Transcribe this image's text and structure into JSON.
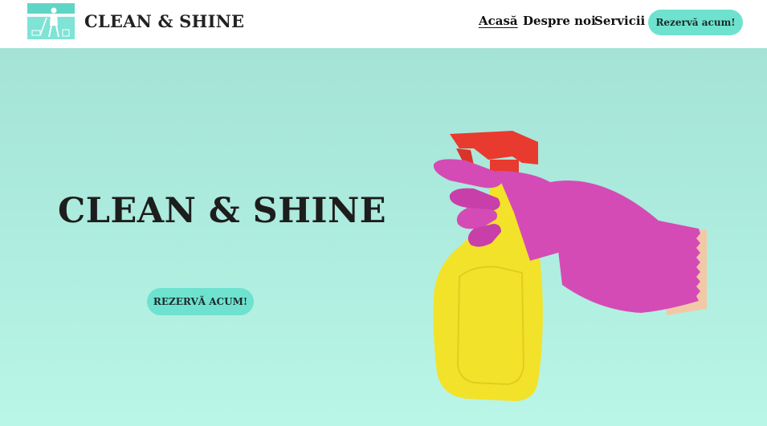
{
  "header": {
    "brand": "CLEAN & SHINE",
    "nav": [
      {
        "label": "Acasă",
        "active": true
      },
      {
        "label": "Despre noi",
        "active": false
      },
      {
        "label": "Servicii",
        "active": false
      }
    ],
    "cta_label": "Rezervă acum!"
  },
  "hero": {
    "title": "CLEAN & SHINE",
    "cta_label": "REZERVĂ ACUM!"
  },
  "colors": {
    "accent": "#6ee2cf",
    "hero_bg": "#aee9dc",
    "glove": "#d54bb5",
    "bottle": "#f3e22a",
    "trigger": "#e83a2e",
    "text": "#1d1d1d"
  },
  "icons": {
    "logo": "cleaning-person-logo",
    "hero_image": "gloved-hand-spray-bottle"
  }
}
